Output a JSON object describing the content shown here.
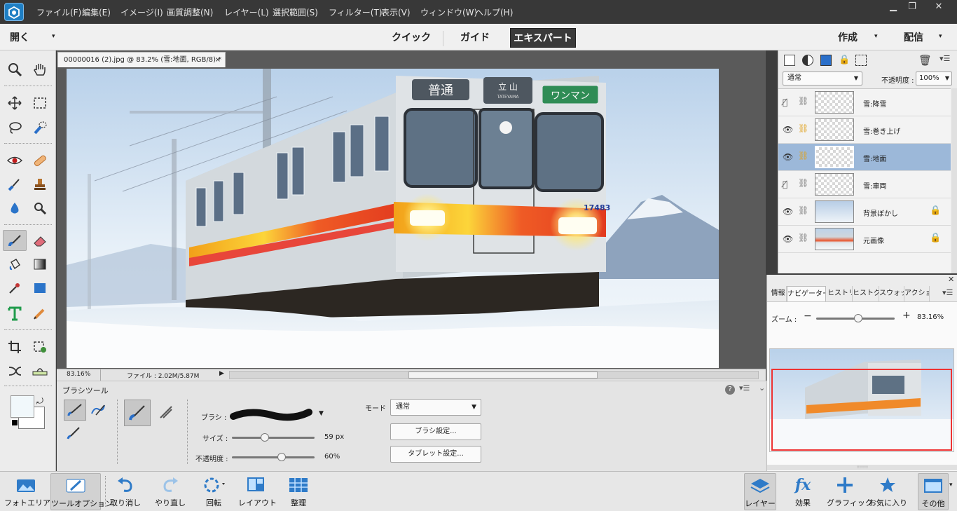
{
  "menu": [
    "ファイル(F)",
    "編集(E)",
    "イメージ(I)",
    "画質調整(N)",
    "レイヤー(L)",
    "選択範囲(S)",
    "フィルター(T)",
    "表示(V)",
    "ウィンドウ(W)",
    "ヘルプ(H)"
  ],
  "modebar": {
    "open": "開く",
    "quick": "クイック",
    "guide": "ガイド",
    "expert": "エキスパート",
    "create": "作成",
    "share": "配信"
  },
  "document": {
    "tab": "00000016 (2).jpg @ 83.2% (雪:地面, RGB/8) *",
    "close": "×",
    "zoom": "83.16%",
    "fileinfo": "ファイル : 2.02M/5.87M"
  },
  "sign": {
    "left": "普通",
    "mid": "立 山",
    "mid_sub": "TATEYAMA",
    "right": "ワンマン",
    "number": "17483"
  },
  "layers": {
    "blend": "通常",
    "opacity_label": "不透明度 :",
    "opacity": "100%",
    "items": [
      {
        "name": "雪:降雪"
      },
      {
        "name": "雪:巻き上げ"
      },
      {
        "name": "雪:地面"
      },
      {
        "name": "雪:車両"
      },
      {
        "name": "背景ぼかし"
      },
      {
        "name": "元画像"
      }
    ]
  },
  "nav": {
    "tabs": [
      "情報",
      "ナビゲーター",
      "ヒストリ",
      "ヒストグ",
      "スウォッ",
      "アクショ"
    ],
    "zoom_label": "ズーム :",
    "zoom": "83.16%",
    "zoom_level": 0.54
  },
  "options": {
    "title": "ブラシツール",
    "brush": "ブラシ :",
    "size": "サイズ :",
    "size_val": "59 px",
    "size_level": 0.4,
    "opacity": "不透明度 :",
    "opacity_val": "60%",
    "opacity_level": 0.6,
    "mode": "モード",
    "mode_val": "通常",
    "brush_settings": "ブラシ設定...",
    "tablet_settings": "タブレット設定..."
  },
  "bottom": {
    "photo_bin": "フォトエリア",
    "tool_options": "ツールオプション",
    "undo": "取り消し",
    "redo": "やり直し",
    "rotate": "回転",
    "layout": "レイアウト",
    "organize": "整理",
    "layers": "レイヤー",
    "effects": "効果",
    "graphics": "グラフィック",
    "favorites": "お気に入り",
    "more": "その他"
  },
  "icons": {
    "zoom": "zoom-icon",
    "hand": "hand-icon",
    "move": "move-icon",
    "marquee": "marquee-icon",
    "lasso": "lasso-icon",
    "quick_select": "quick-select-icon",
    "eye": "red-eye-icon",
    "healing": "healing-icon",
    "smart_brush": "smart-brush-icon",
    "stamp": "stamp-icon",
    "blur": "blur-icon",
    "sponge": "sponge-icon",
    "brush": "brush-icon",
    "eraser": "eraser-icon",
    "bucket": "bucket-icon",
    "gradient": "gradient-icon",
    "eyedropper": "eyedropper-icon",
    "shape": "shape-icon",
    "type": "type-icon",
    "pencil": "pencil-icon",
    "crop": "crop-icon",
    "recompose": "recompose-icon",
    "content_move": "content-aware-move-icon",
    "straighten": "straighten-icon"
  }
}
